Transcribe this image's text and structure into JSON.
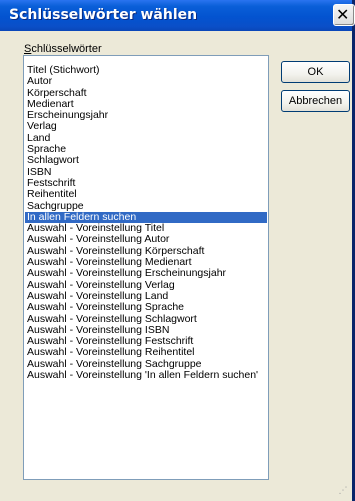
{
  "window": {
    "title": "Schlüsselwörter wählen",
    "close_glyph": "✕"
  },
  "list": {
    "label_mnemonic": "S",
    "label_rest": "chlüsselwörter",
    "selected_index": 13,
    "items": [
      "Titel (Stichwort)",
      "Autor",
      "Körperschaft",
      "Medienart",
      "Erscheinungsjahr",
      "Verlag",
      "Land",
      "Sprache",
      "Schlagwort",
      "ISBN",
      "Festschrift",
      "Reihentitel",
      "Sachgruppe",
      "In allen Feldern suchen",
      "Auswahl - Voreinstellung Titel",
      "Auswahl - Voreinstellung Autor",
      "Auswahl - Voreinstellung Körperschaft",
      "Auswahl - Voreinstellung Medienart",
      "Auswahl - Voreinstellung Erscheinungsjahr",
      "Auswahl - Voreinstellung Verlag",
      "Auswahl - Voreinstellung Land",
      "Auswahl - Voreinstellung Sprache",
      "Auswahl - Voreinstellung Schlagwort",
      "Auswahl - Voreinstellung ISBN",
      "Auswahl - Voreinstellung Festschrift",
      "Auswahl - Voreinstellung Reihentitel",
      "Auswahl - Voreinstellung Sachgruppe",
      "Auswahl - Voreinstellung 'In allen Feldern suchen'"
    ]
  },
  "buttons": {
    "ok": "OK",
    "cancel": "Abbrechen"
  },
  "colors": {
    "titlebar": "#0353d0",
    "dialog_bg": "#ece9d8",
    "selection": "#316ac5"
  }
}
